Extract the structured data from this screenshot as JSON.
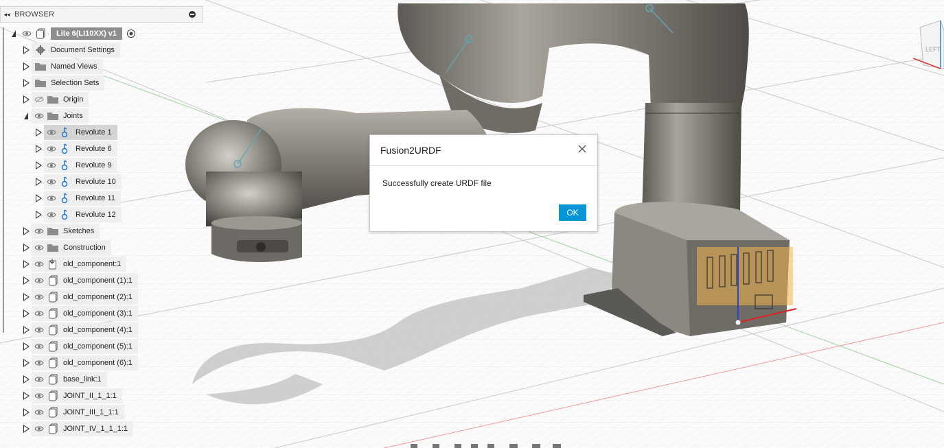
{
  "browser": {
    "title": "BROWSER",
    "root": "Lite 6(LI10XX) v1",
    "items": [
      {
        "label": "Document Settings"
      },
      {
        "label": "Named Views"
      },
      {
        "label": "Selection Sets"
      },
      {
        "label": "Origin"
      },
      {
        "label": "Joints"
      },
      {
        "label": "Revolute 1"
      },
      {
        "label": "Revolute 6"
      },
      {
        "label": "Revolute 9"
      },
      {
        "label": "Revolute 10"
      },
      {
        "label": "Revolute 11"
      },
      {
        "label": "Revolute 12"
      },
      {
        "label": "Sketches"
      },
      {
        "label": "Construction"
      },
      {
        "label": "old_component:1"
      },
      {
        "label": "old_component (1):1"
      },
      {
        "label": "old_component (2):1"
      },
      {
        "label": "old_component (3):1"
      },
      {
        "label": "old_component (4):1"
      },
      {
        "label": "old_component (5):1"
      },
      {
        "label": "old_component (6):1"
      },
      {
        "label": "base_link:1"
      },
      {
        "label": "JOINT_II_1_1:1"
      },
      {
        "label": "JOINT_III_1_1:1"
      },
      {
        "label": "JOINT_IV_1_1_1:1"
      }
    ]
  },
  "dialog": {
    "title": "Fusion2URDF",
    "message": "Successfully create URDF file",
    "ok_label": "OK"
  },
  "viewcube": {
    "face": "LEFT"
  },
  "colors": {
    "accent": "#0696d7",
    "revolute": "#1a73c9",
    "highlight": "#f3b54a"
  }
}
